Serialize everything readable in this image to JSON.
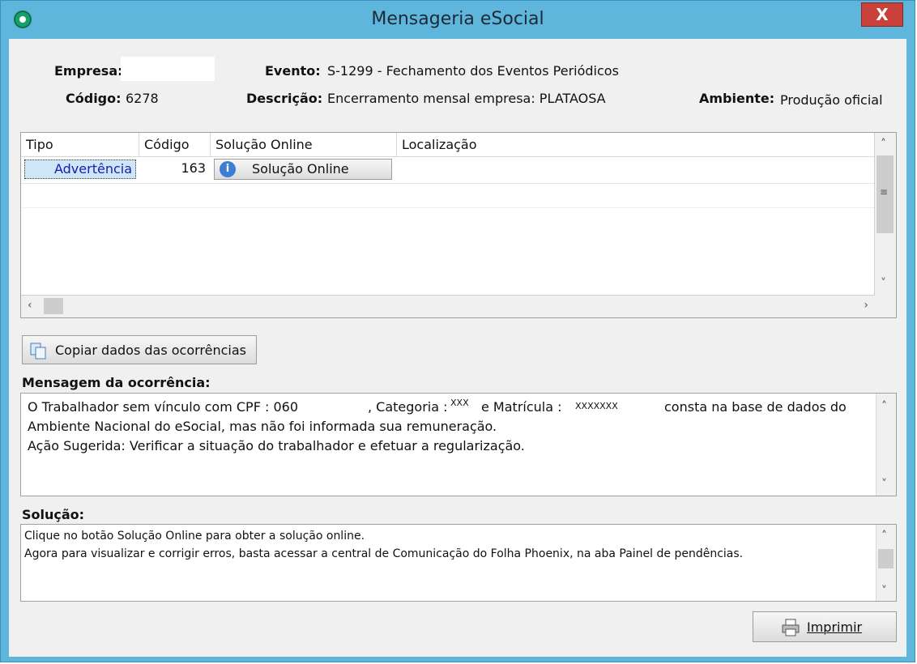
{
  "window": {
    "title": "Mensageria eSocial",
    "close_label": "X"
  },
  "header": {
    "empresa_label": "Empresa:",
    "codigo_label": "Código:",
    "codigo_value": "6278",
    "evento_label": "Evento:",
    "evento_value": "S-1299 - Fechamento dos Eventos Periódicos",
    "descricao_label": "Descrição:",
    "descricao_value": "Encerramento mensal empresa: PLATAOSA",
    "ambiente_label": "Ambiente:",
    "ambiente_value": "Produção oficial"
  },
  "grid": {
    "columns": [
      "Tipo",
      "Código",
      "Solução Online",
      "Localização"
    ],
    "rows": [
      {
        "tipo": "Advertência",
        "codigo": "163",
        "solucao": "Solução Online",
        "localizacao": ""
      }
    ]
  },
  "buttons": {
    "copiar": "Copiar dados das ocorrências",
    "imprimir": "Imprimir"
  },
  "mensagem": {
    "label": "Mensagem da ocorrência:",
    "line1_a": "O Trabalhador sem vínculo com CPF : 060",
    "line1_b": ", Categoria :",
    "line1_c": "XXX",
    "line1_d": "e Matrícula :",
    "line1_e": "XXXXXXX",
    "line1_f": "consta na base de dados do",
    "line2": "Ambiente Nacional do eSocial, mas não foi informada sua remuneração.",
    "line3": "Ação Sugerida: Verificar a situação do trabalhador e efetuar a regularização."
  },
  "solucao": {
    "label": "Solução:",
    "line1": "Clique no botão Solução Online para obter a solução online.",
    "line2": "Agora para visualizar e corrigir erros, basta acessar a central de Comunicação do Folha Phoenix, na aba Painel de pendências."
  },
  "colors": {
    "titlebar": "#5fb6dd",
    "close": "#c9413a",
    "tipo_text": "#1a1ab0"
  }
}
